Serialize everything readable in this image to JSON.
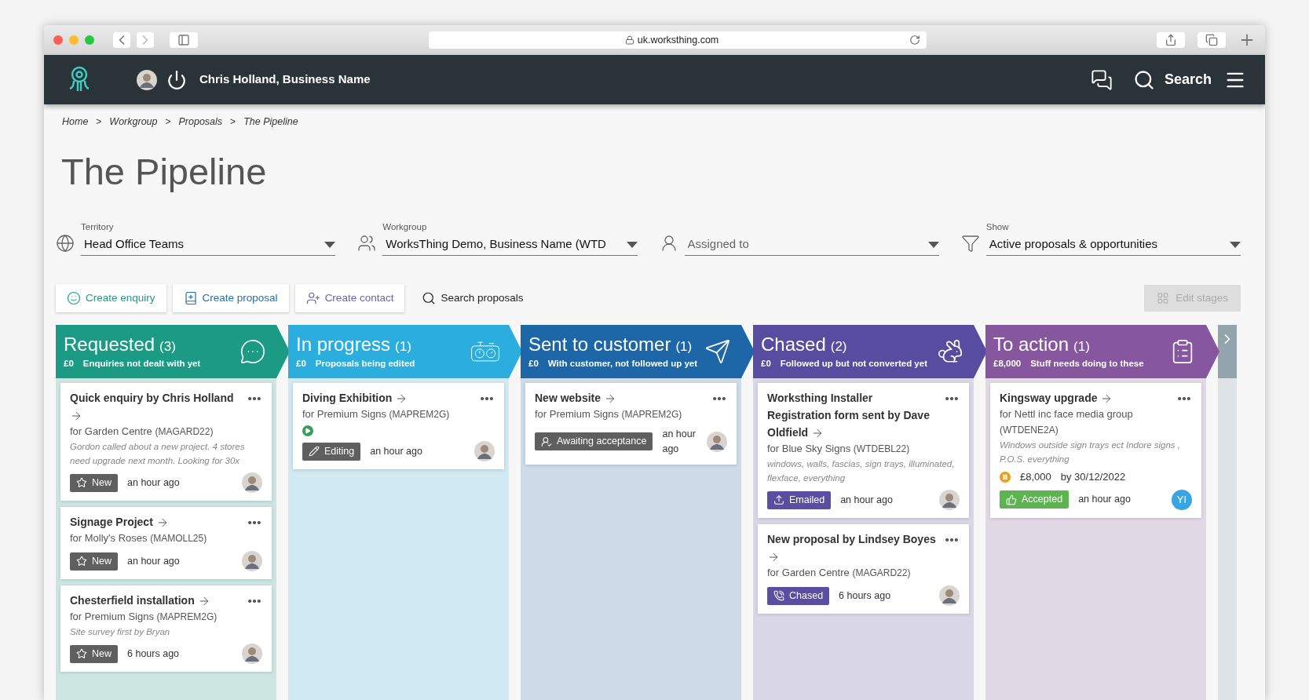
{
  "browser": {
    "url": "uk.worksthing.com"
  },
  "header": {
    "user": "Chris Holland, Business Name",
    "search": "Search"
  },
  "breadcrumb": {
    "separator": ">",
    "items": [
      "Home",
      "Workgroup",
      "Proposals",
      "The Pipeline"
    ]
  },
  "title": "The Pipeline",
  "filters": [
    {
      "kind": "territory",
      "label": "Territory",
      "value": "Head Office Teams"
    },
    {
      "kind": "workgroup",
      "label": "Workgroup",
      "value": "WorksThing Demo, Business Name (WTD"
    },
    {
      "kind": "person",
      "placeholder": "Assigned to"
    },
    {
      "kind": "filter",
      "label": "Show",
      "value": "Active proposals & opportunities"
    }
  ],
  "actions": [
    {
      "kind": "enquiry",
      "label": "Create enquiry",
      "color": "#1a9c86"
    },
    {
      "kind": "proposal",
      "label": "Create proposal",
      "color": "#1f6fae"
    },
    {
      "kind": "contact",
      "label": "Create contact",
      "color": "#6f62a8"
    },
    {
      "kind": "search",
      "label": "Search proposals",
      "color": "#222222"
    }
  ],
  "edit_stages": {
    "label": "Edit stages",
    "disabled": true
  },
  "columns": [
    {
      "title": "Requested",
      "count": "(3)",
      "amount": "£0",
      "description": "Enquiries not dealt with yet",
      "color": "#1b9a84",
      "kind": "chat",
      "cards": [
        {
          "title": "Quick enquiry by Chris Holland",
          "client": "for Garden Centre",
          "code": "(MAGARD22)",
          "note": "Gordon called about a new project. 4 stores need upgrade next month. Looking for 30x",
          "status": {
            "kind": "new",
            "label": "New"
          },
          "time": "an hour ago",
          "avatar": {
            "kind": "photo"
          }
        },
        {
          "title": "Signage Project",
          "client": "for Molly's Roses",
          "code": "(MAMOLL25)",
          "status": {
            "kind": "new",
            "label": "New"
          },
          "time": "an hour ago",
          "avatar": {
            "kind": "photo"
          }
        },
        {
          "title": "Chesterfield installation",
          "client": "for Premium Signs",
          "code": "(MAPREM2G)",
          "note": "Site survey first by Bryan",
          "status": {
            "kind": "new",
            "label": "New"
          },
          "time": "6 hours ago",
          "avatar": {
            "kind": "photo"
          }
        }
      ]
    },
    {
      "title": "In progress",
      "count": "(1)",
      "amount": "£0",
      "description": "Proposals being edited",
      "color": "#2badde",
      "kind": "dials",
      "cards": [
        {
          "title": "Diving Exhibition",
          "client": "for Premium Signs",
          "code": "(MAPREM2G)",
          "indicator": {
            "kind": "play"
          },
          "status": {
            "kind": "editing",
            "label": "Editing"
          },
          "time": "an hour ago",
          "avatar": {
            "kind": "photo"
          }
        }
      ]
    },
    {
      "title": "Sent to customer",
      "count": "(1)",
      "amount": "£0",
      "description": "With customer, not followed up yet",
      "color": "#1d67a8",
      "kind": "plane",
      "cards": [
        {
          "title": "New website",
          "client": "for Premium Signs",
          "code": "(MAPREM2G)",
          "status": {
            "kind": "awaiting",
            "label": "Awaiting acceptance"
          },
          "time": "an hour ago",
          "avatar": {
            "kind": "photo"
          }
        }
      ]
    },
    {
      "title": "Chased",
      "count": "(2)",
      "amount": "£0",
      "description": "Followed up but not converted yet",
      "color": "#584ca0",
      "kind": "rabbit",
      "cards": [
        {
          "title": "Worksthing Installer Registration form sent by Dave Oldfield",
          "client": "for Blue Sky Signs",
          "code": "(WTDEBL22)",
          "note": "windows, walls, fascias, sign trays, illuminated, flexface, everything",
          "status": {
            "kind": "emailed",
            "label": "Emailed"
          },
          "time": "an hour ago",
          "avatar": {
            "kind": "photo"
          }
        },
        {
          "title": "New proposal by Lindsey Boyes",
          "client": "for Garden Centre",
          "code": "(MAGARD22)",
          "status": {
            "kind": "chased",
            "label": "Chased"
          },
          "time": "6 hours ago",
          "avatar": {
            "kind": "photo"
          }
        }
      ]
    },
    {
      "title": "To action",
      "count": "(1)",
      "amount": "£8,000",
      "description": "Stuff needs doing to these",
      "color": "#86579f",
      "kind": "clipboard",
      "cards": [
        {
          "title": "Kingsway upgrade",
          "client": "for Nettl inc face media group",
          "code": "(WTDENE2A)",
          "note": "Windows outside sign trays ect Indore signs , P.O.S. everything",
          "indicator": {
            "kind": "pause"
          },
          "value": "£8,000",
          "due": "by 30/12/2022",
          "status": {
            "kind": "accepted",
            "label": "Accepted"
          },
          "time": "an hour ago",
          "avatar": {
            "kind": "initials",
            "text": "YI"
          }
        }
      ]
    }
  ]
}
